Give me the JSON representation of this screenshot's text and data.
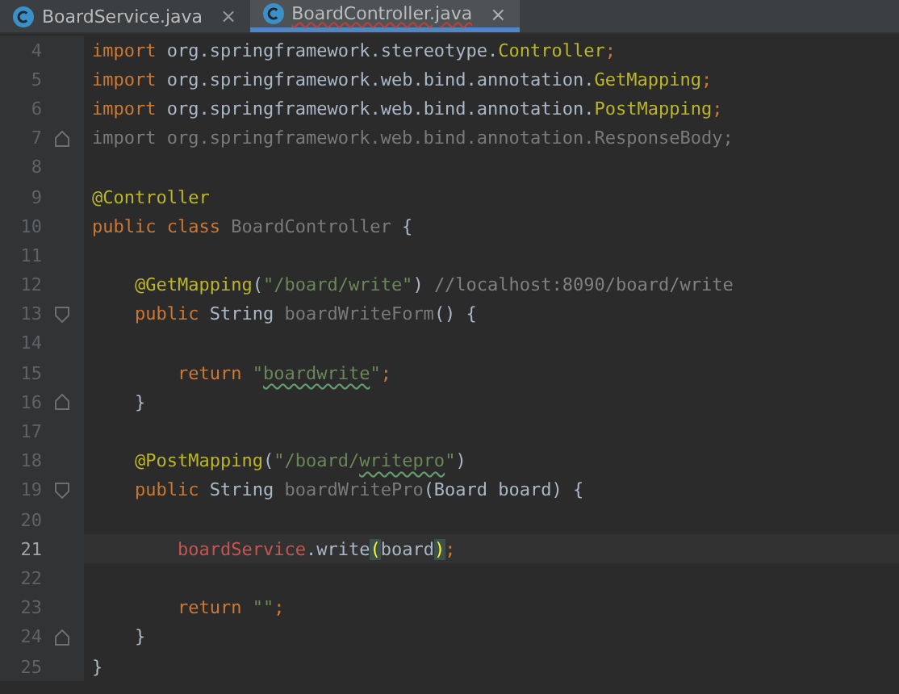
{
  "tabs": [
    {
      "label": "BoardService.java",
      "selected": false,
      "error": false,
      "close": "×"
    },
    {
      "label": "BoardController.java",
      "selected": true,
      "error": true,
      "close": "×"
    }
  ],
  "lines": [
    {
      "number": "4",
      "current": false,
      "tokens": [
        {
          "kind": "kw",
          "text": "import"
        },
        {
          "kind": "plain",
          "text": " org.springframework.stereotype."
        },
        {
          "kind": "ann",
          "text": "Controller"
        },
        {
          "kind": "kw",
          "text": ";"
        }
      ]
    },
    {
      "number": "5",
      "current": false,
      "tokens": [
        {
          "kind": "kw",
          "text": "import"
        },
        {
          "kind": "plain",
          "text": " org.springframework.web.bind.annotation."
        },
        {
          "kind": "ann",
          "text": "GetMapping"
        },
        {
          "kind": "kw",
          "text": ";"
        }
      ]
    },
    {
      "number": "6",
      "current": false,
      "tokens": [
        {
          "kind": "kw",
          "text": "import"
        },
        {
          "kind": "plain",
          "text": " org.springframework.web.bind.annotation."
        },
        {
          "kind": "ann",
          "text": "PostMapping"
        },
        {
          "kind": "kw",
          "text": ";"
        }
      ]
    },
    {
      "number": "7",
      "current": false,
      "fold_end": true,
      "tokens": [
        {
          "kind": "unused",
          "text": "import org.springframework.web.bind.annotation.ResponseBody;"
        }
      ]
    },
    {
      "number": "8",
      "current": false
    },
    {
      "number": "9",
      "current": false,
      "tokens": [
        {
          "kind": "ann",
          "text": "@Controller"
        }
      ]
    },
    {
      "number": "10",
      "current": false,
      "tokens": [
        {
          "kind": "kw",
          "text": "public class "
        },
        {
          "kind": "unused",
          "text": "BoardController"
        },
        {
          "kind": "plain",
          "text": " {"
        }
      ]
    },
    {
      "number": "11",
      "current": false
    },
    {
      "number": "12",
      "current": false,
      "tokens": [
        {
          "kind": "ann",
          "text": "    @GetMapping"
        },
        {
          "kind": "plain",
          "text": "("
        },
        {
          "kind": "str",
          "text": "\"/board/write\""
        },
        {
          "kind": "plain",
          "text": ") "
        },
        {
          "kind": "comment",
          "text": "//localhost:8090/board/write"
        }
      ]
    },
    {
      "number": "13",
      "current": false,
      "fold_start": true,
      "tokens": [
        {
          "kind": "kw",
          "text": "    public "
        },
        {
          "kind": "plain",
          "text": "String "
        },
        {
          "kind": "unused",
          "text": "boardWriteForm"
        },
        {
          "kind": "plain",
          "text": "() {"
        }
      ]
    },
    {
      "number": "14",
      "current": false
    },
    {
      "number": "15",
      "current": false,
      "tokens": [
        {
          "kind": "kw",
          "text": "        return "
        },
        {
          "kind": "str",
          "text": "\""
        },
        {
          "kind": "typo",
          "text": "boardwrite"
        },
        {
          "kind": "str",
          "text": "\""
        },
        {
          "kind": "kw",
          "text": ";"
        }
      ]
    },
    {
      "number": "16",
      "current": false,
      "fold_end": true,
      "tokens": [
        {
          "kind": "plain",
          "text": "    }"
        }
      ]
    },
    {
      "number": "17",
      "current": false
    },
    {
      "number": "18",
      "current": false,
      "tokens": [
        {
          "kind": "ann",
          "text": "    @PostMapping"
        },
        {
          "kind": "plain",
          "text": "("
        },
        {
          "kind": "str",
          "text": "\"/board/"
        },
        {
          "kind": "typo",
          "text": "writepro"
        },
        {
          "kind": "str",
          "text": "\""
        },
        {
          "kind": "plain",
          "text": ")"
        }
      ]
    },
    {
      "number": "19",
      "current": false,
      "fold_start": true,
      "tokens": [
        {
          "kind": "kw",
          "text": "    public "
        },
        {
          "kind": "plain",
          "text": "String "
        },
        {
          "kind": "unused",
          "text": "boardWritePro"
        },
        {
          "kind": "plain",
          "text": "(Board board) {"
        }
      ]
    },
    {
      "number": "20",
      "current": false
    },
    {
      "number": "21",
      "current": true,
      "tokens": [
        {
          "kind": "error",
          "text": "        boardService"
        },
        {
          "kind": "plain",
          "text": ".write"
        },
        {
          "kind": "match",
          "text": "("
        },
        {
          "kind": "plain",
          "text": "board"
        },
        {
          "kind": "match",
          "text": ")"
        },
        {
          "kind": "kw",
          "text": ";"
        }
      ]
    },
    {
      "number": "22",
      "current": false
    },
    {
      "number": "23",
      "current": false,
      "tokens": [
        {
          "kind": "kw",
          "text": "        return "
        },
        {
          "kind": "str",
          "text": "\"\""
        },
        {
          "kind": "kw",
          "text": ";"
        }
      ]
    },
    {
      "number": "24",
      "current": false,
      "fold_end": true,
      "tokens": [
        {
          "kind": "plain",
          "text": "    }"
        }
      ]
    },
    {
      "number": "25",
      "current": false,
      "tokens": [
        {
          "kind": "plain",
          "text": "}"
        }
      ]
    }
  ]
}
